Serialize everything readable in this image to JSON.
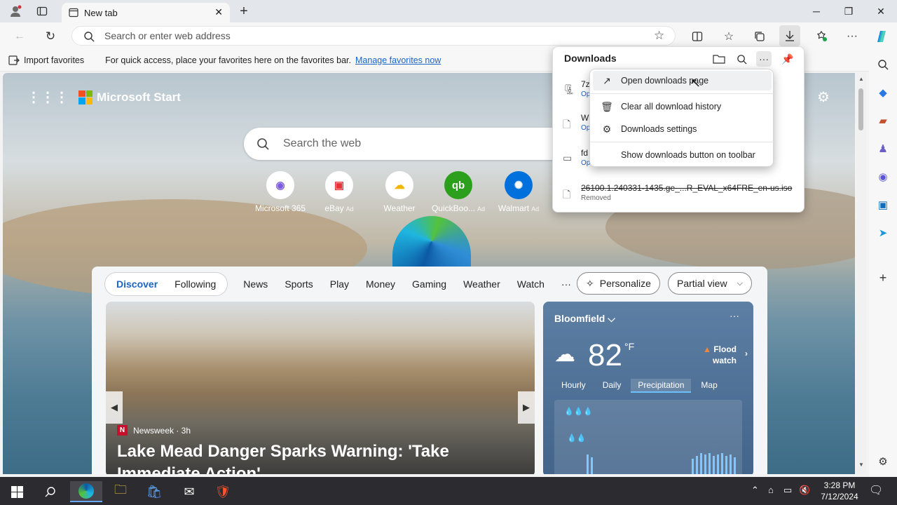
{
  "browser": {
    "tab_title": "New tab",
    "address_placeholder": "Search or enter web address"
  },
  "favorites_bar": {
    "import_label": "Import favorites",
    "message": "For quick access, place your favorites here on the favorites bar.",
    "manage_link": "Manage favorites now"
  },
  "page": {
    "brand": "Microsoft Start",
    "search_placeholder": "Search the web",
    "quick_links": [
      {
        "label": "Microsoft 365",
        "ad": ""
      },
      {
        "label": "eBay",
        "ad": "Ad"
      },
      {
        "label": "Weather",
        "ad": ""
      },
      {
        "label": "QuickBoo...",
        "ad": "Ad"
      },
      {
        "label": "Walmart",
        "ad": "Ad"
      }
    ],
    "feed_tabs": [
      "Discover",
      "Following"
    ],
    "feed_categories": [
      "News",
      "Sports",
      "Play",
      "Money",
      "Gaming",
      "Weather",
      "Watch",
      "···"
    ],
    "personalize_label": "Personalize",
    "view_label": "Partial view",
    "article": {
      "source_badge": "N",
      "source": "Newsweek · 3h",
      "headline": "Lake Mead Danger Sparks Warning: 'Take Immediate Action'"
    },
    "weather": {
      "location": "Bloomfield",
      "temperature": "82",
      "unit": "°F",
      "alert": "Flood watch",
      "tabs": [
        "Hourly",
        "Daily",
        "Precipitation",
        "Map"
      ],
      "active_tab": "Precipitation"
    }
  },
  "downloads": {
    "title": "Downloads",
    "items": [
      {
        "name": "7z",
        "status": "Op"
      },
      {
        "name": "W",
        "status": "Op"
      },
      {
        "name": "fd",
        "status": "Op"
      },
      {
        "name": "26100.1.240331-1435.ge_...R_EVAL_x64FRE_en-us.iso",
        "status": "Removed"
      }
    ]
  },
  "context_menu": {
    "items": [
      {
        "label": "Open downloads page"
      },
      {
        "label": "Clear all download history"
      },
      {
        "label": "Downloads settings"
      },
      {
        "label": "Show downloads button on toolbar"
      }
    ]
  },
  "taskbar": {
    "time": "3:28 PM",
    "date": "7/12/2024"
  }
}
